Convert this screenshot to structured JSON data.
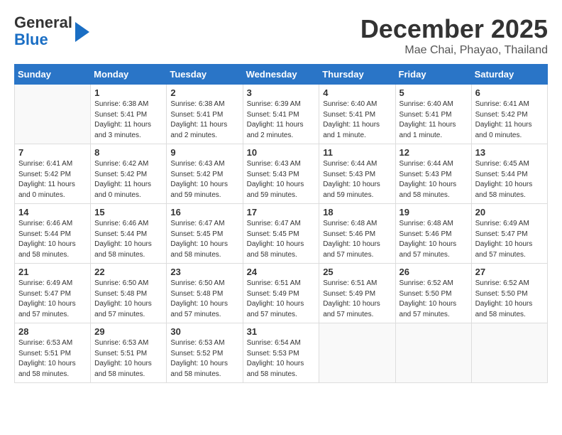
{
  "header": {
    "logo_line1": "General",
    "logo_line2": "Blue",
    "month_title": "December 2025",
    "location": "Mae Chai, Phayao, Thailand"
  },
  "days_of_week": [
    "Sunday",
    "Monday",
    "Tuesday",
    "Wednesday",
    "Thursday",
    "Friday",
    "Saturday"
  ],
  "weeks": [
    [
      {
        "day": "",
        "sunrise": "",
        "sunset": "",
        "daylight": ""
      },
      {
        "day": "1",
        "sunrise": "Sunrise: 6:38 AM",
        "sunset": "Sunset: 5:41 PM",
        "daylight": "Daylight: 11 hours and 3 minutes."
      },
      {
        "day": "2",
        "sunrise": "Sunrise: 6:38 AM",
        "sunset": "Sunset: 5:41 PM",
        "daylight": "Daylight: 11 hours and 2 minutes."
      },
      {
        "day": "3",
        "sunrise": "Sunrise: 6:39 AM",
        "sunset": "Sunset: 5:41 PM",
        "daylight": "Daylight: 11 hours and 2 minutes."
      },
      {
        "day": "4",
        "sunrise": "Sunrise: 6:40 AM",
        "sunset": "Sunset: 5:41 PM",
        "daylight": "Daylight: 11 hours and 1 minute."
      },
      {
        "day": "5",
        "sunrise": "Sunrise: 6:40 AM",
        "sunset": "Sunset: 5:41 PM",
        "daylight": "Daylight: 11 hours and 1 minute."
      },
      {
        "day": "6",
        "sunrise": "Sunrise: 6:41 AM",
        "sunset": "Sunset: 5:42 PM",
        "daylight": "Daylight: 11 hours and 0 minutes."
      }
    ],
    [
      {
        "day": "7",
        "sunrise": "Sunrise: 6:41 AM",
        "sunset": "Sunset: 5:42 PM",
        "daylight": "Daylight: 11 hours and 0 minutes."
      },
      {
        "day": "8",
        "sunrise": "Sunrise: 6:42 AM",
        "sunset": "Sunset: 5:42 PM",
        "daylight": "Daylight: 11 hours and 0 minutes."
      },
      {
        "day": "9",
        "sunrise": "Sunrise: 6:43 AM",
        "sunset": "Sunset: 5:42 PM",
        "daylight": "Daylight: 10 hours and 59 minutes."
      },
      {
        "day": "10",
        "sunrise": "Sunrise: 6:43 AM",
        "sunset": "Sunset: 5:43 PM",
        "daylight": "Daylight: 10 hours and 59 minutes."
      },
      {
        "day": "11",
        "sunrise": "Sunrise: 6:44 AM",
        "sunset": "Sunset: 5:43 PM",
        "daylight": "Daylight: 10 hours and 59 minutes."
      },
      {
        "day": "12",
        "sunrise": "Sunrise: 6:44 AM",
        "sunset": "Sunset: 5:43 PM",
        "daylight": "Daylight: 10 hours and 58 minutes."
      },
      {
        "day": "13",
        "sunrise": "Sunrise: 6:45 AM",
        "sunset": "Sunset: 5:44 PM",
        "daylight": "Daylight: 10 hours and 58 minutes."
      }
    ],
    [
      {
        "day": "14",
        "sunrise": "Sunrise: 6:46 AM",
        "sunset": "Sunset: 5:44 PM",
        "daylight": "Daylight: 10 hours and 58 minutes."
      },
      {
        "day": "15",
        "sunrise": "Sunrise: 6:46 AM",
        "sunset": "Sunset: 5:44 PM",
        "daylight": "Daylight: 10 hours and 58 minutes."
      },
      {
        "day": "16",
        "sunrise": "Sunrise: 6:47 AM",
        "sunset": "Sunset: 5:45 PM",
        "daylight": "Daylight: 10 hours and 58 minutes."
      },
      {
        "day": "17",
        "sunrise": "Sunrise: 6:47 AM",
        "sunset": "Sunset: 5:45 PM",
        "daylight": "Daylight: 10 hours and 58 minutes."
      },
      {
        "day": "18",
        "sunrise": "Sunrise: 6:48 AM",
        "sunset": "Sunset: 5:46 PM",
        "daylight": "Daylight: 10 hours and 57 minutes."
      },
      {
        "day": "19",
        "sunrise": "Sunrise: 6:48 AM",
        "sunset": "Sunset: 5:46 PM",
        "daylight": "Daylight: 10 hours and 57 minutes."
      },
      {
        "day": "20",
        "sunrise": "Sunrise: 6:49 AM",
        "sunset": "Sunset: 5:47 PM",
        "daylight": "Daylight: 10 hours and 57 minutes."
      }
    ],
    [
      {
        "day": "21",
        "sunrise": "Sunrise: 6:49 AM",
        "sunset": "Sunset: 5:47 PM",
        "daylight": "Daylight: 10 hours and 57 minutes."
      },
      {
        "day": "22",
        "sunrise": "Sunrise: 6:50 AM",
        "sunset": "Sunset: 5:48 PM",
        "daylight": "Daylight: 10 hours and 57 minutes."
      },
      {
        "day": "23",
        "sunrise": "Sunrise: 6:50 AM",
        "sunset": "Sunset: 5:48 PM",
        "daylight": "Daylight: 10 hours and 57 minutes."
      },
      {
        "day": "24",
        "sunrise": "Sunrise: 6:51 AM",
        "sunset": "Sunset: 5:49 PM",
        "daylight": "Daylight: 10 hours and 57 minutes."
      },
      {
        "day": "25",
        "sunrise": "Sunrise: 6:51 AM",
        "sunset": "Sunset: 5:49 PM",
        "daylight": "Daylight: 10 hours and 57 minutes."
      },
      {
        "day": "26",
        "sunrise": "Sunrise: 6:52 AM",
        "sunset": "Sunset: 5:50 PM",
        "daylight": "Daylight: 10 hours and 57 minutes."
      },
      {
        "day": "27",
        "sunrise": "Sunrise: 6:52 AM",
        "sunset": "Sunset: 5:50 PM",
        "daylight": "Daylight: 10 hours and 58 minutes."
      }
    ],
    [
      {
        "day": "28",
        "sunrise": "Sunrise: 6:53 AM",
        "sunset": "Sunset: 5:51 PM",
        "daylight": "Daylight: 10 hours and 58 minutes."
      },
      {
        "day": "29",
        "sunrise": "Sunrise: 6:53 AM",
        "sunset": "Sunset: 5:51 PM",
        "daylight": "Daylight: 10 hours and 58 minutes."
      },
      {
        "day": "30",
        "sunrise": "Sunrise: 6:53 AM",
        "sunset": "Sunset: 5:52 PM",
        "daylight": "Daylight: 10 hours and 58 minutes."
      },
      {
        "day": "31",
        "sunrise": "Sunrise: 6:54 AM",
        "sunset": "Sunset: 5:53 PM",
        "daylight": "Daylight: 10 hours and 58 minutes."
      },
      {
        "day": "",
        "sunrise": "",
        "sunset": "",
        "daylight": ""
      },
      {
        "day": "",
        "sunrise": "",
        "sunset": "",
        "daylight": ""
      },
      {
        "day": "",
        "sunrise": "",
        "sunset": "",
        "daylight": ""
      }
    ]
  ]
}
